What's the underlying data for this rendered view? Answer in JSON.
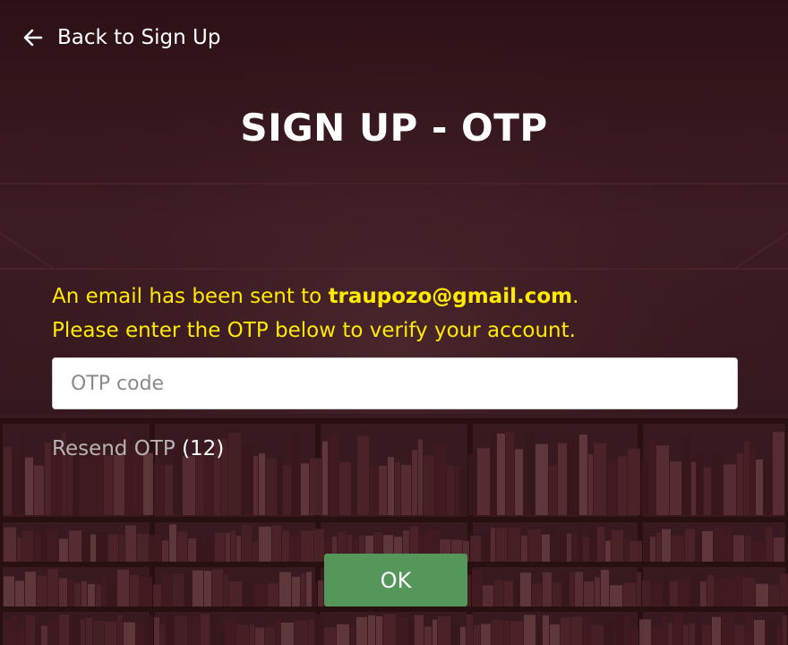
{
  "nav": {
    "back_label": "Back to Sign Up",
    "back_icon": "arrow-left-icon"
  },
  "page": {
    "title": "SIGN UP - OTP"
  },
  "message": {
    "prefix": "An email has been sent to ",
    "email": "traupozo@gmail.com",
    "suffix": ".",
    "line2": "Please enter the OTP below to verify your account."
  },
  "otp_input": {
    "placeholder": "OTP code",
    "value": ""
  },
  "resend": {
    "label": "Resend OTP",
    "countdown": "(12)"
  },
  "actions": {
    "ok_label": "OK"
  },
  "colors": {
    "message": "#ffea00",
    "ok_button": "#55965a",
    "background": "#3a1a20",
    "resend_link": "#b8b2b3"
  }
}
